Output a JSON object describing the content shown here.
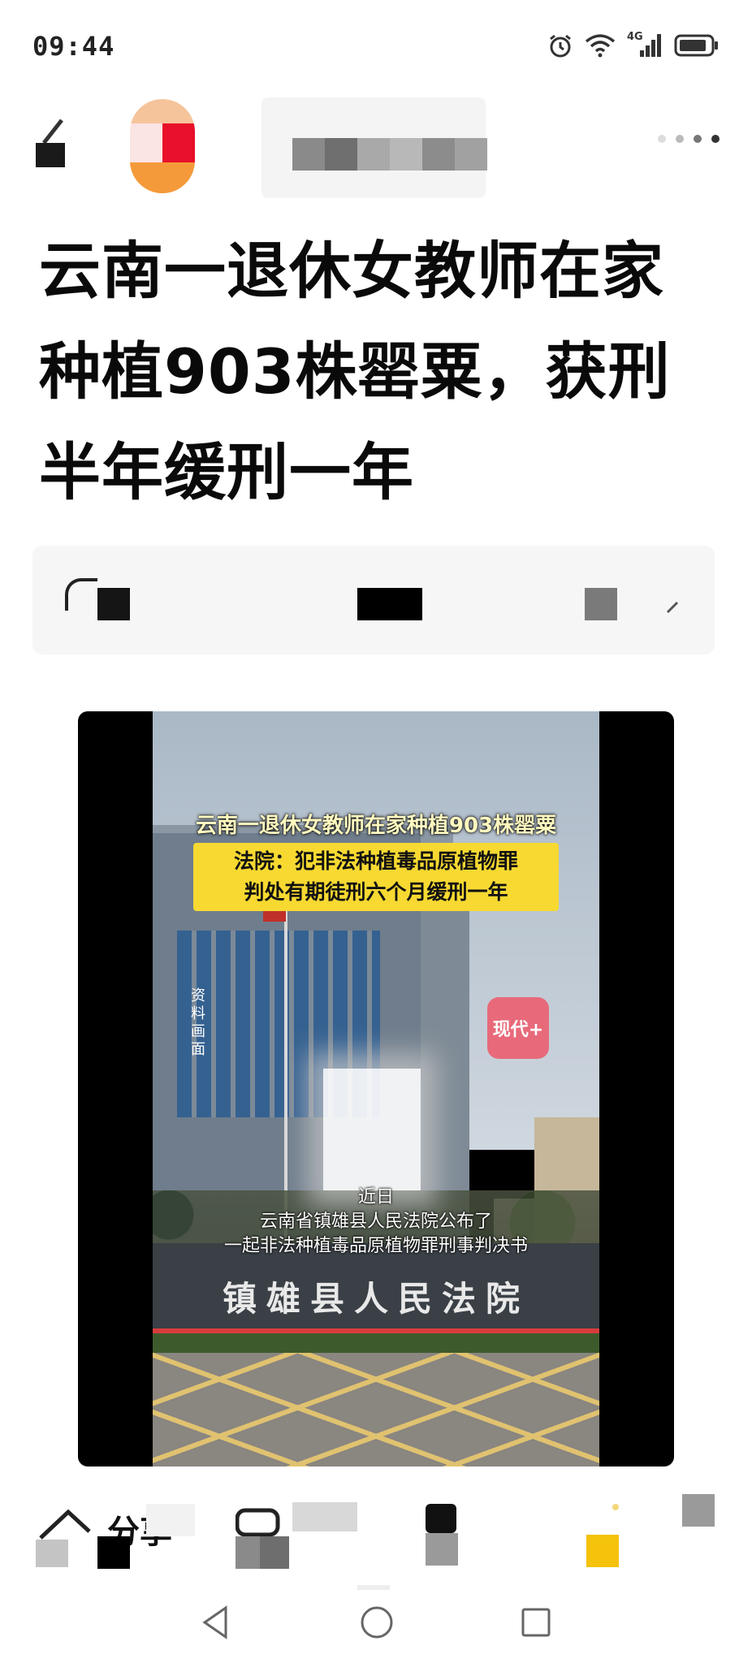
{
  "status_bar": {
    "time": "09:44",
    "network": "4G",
    "icons": [
      "alarm-icon",
      "wifi-icon",
      "signal-icon",
      "battery-icon"
    ]
  },
  "top_nav": {
    "back_icon": "back-arrow-icon",
    "more_icon": "more-dots-icon"
  },
  "article": {
    "title": "云南一退休女教师在家种植903株罂粟，获刑半年缓刑一年"
  },
  "video": {
    "caption_top": "云南一退休女教师在家种植903株罂粟",
    "caption_box_line1": "法院：犯非法种植毒品原植物罪",
    "caption_box_line2": "判处有期徒刑六个月缓刑一年",
    "side_label": "资料画面",
    "logo_text": "现代+",
    "subtitle_line1": "近日",
    "subtitle_line2": "云南省镇雄县人民法院公布了",
    "subtitle_line3": "一起非法种植毒品原植物罪刑事判决书",
    "court_sign": "镇雄县人民法院"
  },
  "action_bar": {
    "share_label": "分享"
  },
  "colors": {
    "caption_yellow": "#f7d931",
    "collect_yellow": "#f5c20c",
    "logo_pink": "#e86a7a"
  }
}
